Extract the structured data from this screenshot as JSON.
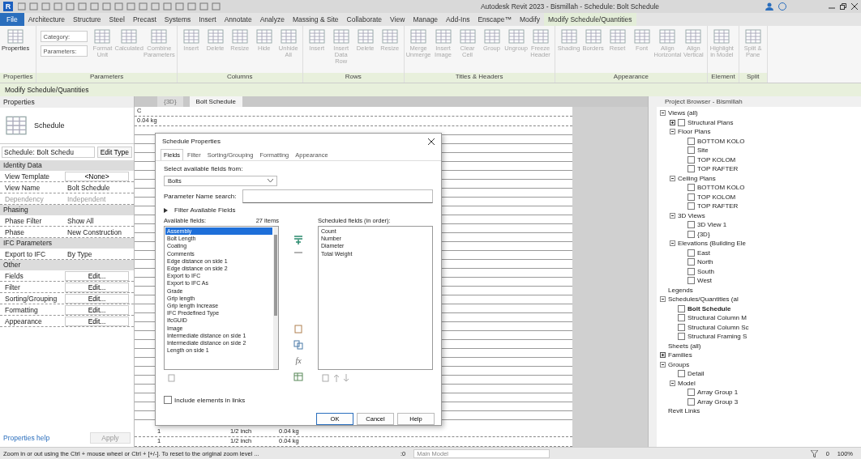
{
  "title_bar": {
    "logo": "R",
    "title": "Autodesk Revit 2023 - Bismillah - Schedule: Bolt Schedule"
  },
  "ribbon_tabs": [
    {
      "label": "File",
      "selected": false,
      "kind": "file"
    },
    {
      "label": "Architecture",
      "selected": false,
      "kind": "tab"
    },
    {
      "label": "Structure",
      "selected": false,
      "kind": "tab"
    },
    {
      "label": "Steel",
      "selected": false,
      "kind": "tab"
    },
    {
      "label": "Precast",
      "selected": false,
      "kind": "tab"
    },
    {
      "label": "Systems",
      "selected": false,
      "kind": "tab"
    },
    {
      "label": "Insert",
      "selected": false,
      "kind": "tab"
    },
    {
      "label": "Annotate",
      "selected": false,
      "kind": "tab"
    },
    {
      "label": "Analyze",
      "selected": false,
      "kind": "tab"
    },
    {
      "label": "Massing & Site",
      "selected": false,
      "kind": "tab"
    },
    {
      "label": "Collaborate",
      "selected": false,
      "kind": "tab"
    },
    {
      "label": "View",
      "selected": false,
      "kind": "tab"
    },
    {
      "label": "Manage",
      "selected": false,
      "kind": "tab"
    },
    {
      "label": "Add-Ins",
      "selected": false,
      "kind": "tab"
    },
    {
      "label": "Enscape™",
      "selected": false,
      "kind": "tab"
    },
    {
      "label": "Modify",
      "selected": false,
      "kind": "tab"
    },
    {
      "label": "Modify Schedule/Quantities",
      "selected": true,
      "kind": "tab"
    }
  ],
  "ribbon_panels": [
    {
      "label": "Properties",
      "buttons": [
        {
          "kind": "large",
          "label": "Properties",
          "disabled": false
        }
      ]
    },
    {
      "label": "Parameters",
      "buttons": [
        {
          "kind": "dropdowns",
          "items": [
            "Category:",
            "Parameters:"
          ]
        },
        {
          "kind": "large",
          "label": "Format Unit",
          "disabled": true
        },
        {
          "kind": "large",
          "label": "Calculated",
          "disabled": true
        },
        {
          "kind": "large",
          "label": "Combine Parameters",
          "disabled": true
        }
      ]
    },
    {
      "label": "Columns",
      "buttons": [
        {
          "kind": "large",
          "label": "Insert",
          "disabled": true
        },
        {
          "kind": "large",
          "label": "Delete",
          "disabled": true
        },
        {
          "kind": "large",
          "label": "Resize",
          "disabled": true
        },
        {
          "kind": "large",
          "label": "Hide",
          "disabled": true
        },
        {
          "kind": "large",
          "label": "Unhide All",
          "disabled": true
        }
      ]
    },
    {
      "label": "Rows",
      "buttons": [
        {
          "kind": "large",
          "label": "Insert",
          "disabled": true
        },
        {
          "kind": "large",
          "label": "Insert Data Row",
          "disabled": true
        },
        {
          "kind": "large",
          "label": "Delete",
          "disabled": true
        },
        {
          "kind": "large",
          "label": "Resize",
          "disabled": true
        }
      ]
    },
    {
      "label": "Titles & Headers",
      "buttons": [
        {
          "kind": "large",
          "label": "Merge Unmerge",
          "disabled": true
        },
        {
          "kind": "large",
          "label": "Insert Image",
          "disabled": true
        },
        {
          "kind": "large",
          "label": "Clear Cell",
          "disabled": true
        },
        {
          "kind": "large",
          "label": "Group",
          "disabled": true
        },
        {
          "kind": "large",
          "label": "Ungroup",
          "disabled": true
        },
        {
          "kind": "large",
          "label": "Freeze Header",
          "disabled": true
        }
      ]
    },
    {
      "label": "Appearance",
      "buttons": [
        {
          "kind": "large",
          "label": "Shading",
          "disabled": true
        },
        {
          "kind": "large",
          "label": "Borders",
          "disabled": true
        },
        {
          "kind": "large",
          "label": "Reset",
          "disabled": true
        },
        {
          "kind": "large",
          "label": "Font",
          "disabled": true
        },
        {
          "kind": "large",
          "label": "Align Horizontal",
          "disabled": true
        },
        {
          "kind": "large",
          "label": "Align Vertical",
          "disabled": true
        }
      ]
    },
    {
      "label": "Element",
      "buttons": [
        {
          "kind": "large",
          "label": "Highlight in Model",
          "disabled": true
        }
      ]
    },
    {
      "label": "Split",
      "buttons": [
        {
          "kind": "large",
          "label": "Split & Pane",
          "disabled": true
        }
      ]
    }
  ],
  "context_label": "Modify Schedule/Quantities",
  "properties": {
    "title": "Properties",
    "type_name": "Schedule",
    "instance": "Schedule: Bolt Schedu",
    "edit_type": "Edit Type",
    "groups": [
      {
        "name": "Identity Data",
        "rows": [
          {
            "label": "View Template",
            "value": "<None>",
            "kind": "button",
            "disabled": false
          },
          {
            "label": "View Name",
            "value": "Bolt Schedule",
            "kind": "text",
            "disabled": false
          },
          {
            "label": "Dependency",
            "value": "Independent",
            "kind": "text",
            "disabled": true
          }
        ]
      },
      {
        "name": "Phasing",
        "rows": [
          {
            "label": "Phase Filter",
            "value": "Show All",
            "kind": "text",
            "disabled": false
          },
          {
            "label": "Phase",
            "value": "New Construction",
            "kind": "text",
            "disabled": false
          }
        ]
      },
      {
        "name": "IFC Parameters",
        "rows": [
          {
            "label": "Export to IFC",
            "value": "By Type",
            "kind": "text",
            "disabled": false
          }
        ]
      },
      {
        "name": "Other",
        "rows": [
          {
            "label": "Fields",
            "value": "Edit...",
            "kind": "button",
            "disabled": false
          },
          {
            "label": "Filter",
            "value": "Edit...",
            "kind": "button",
            "disabled": false
          },
          {
            "label": "Sorting/Grouping",
            "value": "Edit...",
            "kind": "button",
            "disabled": false
          },
          {
            "label": "Formatting",
            "value": "Edit...",
            "kind": "button",
            "disabled": false
          },
          {
            "label": "Appearance",
            "value": "Edit...",
            "kind": "button",
            "disabled": false
          }
        ]
      }
    ],
    "help_link": "Properties help",
    "apply": "Apply"
  },
  "view_tabs": [
    {
      "label": "{3D}",
      "selected": false
    },
    {
      "label": "Bolt Schedule",
      "selected": true
    }
  ],
  "schedule": {
    "column_header": "C",
    "top_cell": "0.04 kg",
    "bottom_rows": [
      [
        "1",
        "1/2 inch",
        "0.04 kg"
      ],
      [
        "1",
        "1/2 inch",
        "0.04 kg"
      ]
    ]
  },
  "dialog": {
    "title": "Schedule Properties",
    "tabs": [
      {
        "label": "Fields",
        "selected": true
      },
      {
        "label": "Filter",
        "selected": false
      },
      {
        "label": "Sorting/Grouping",
        "selected": false
      },
      {
        "label": "Formatting",
        "selected": false
      },
      {
        "label": "Appearance",
        "selected": false
      }
    ],
    "source_label": "Select available fields from:",
    "source_value": "Bolts",
    "search_label": "Parameter Name search:",
    "filter_toggle": "Filter Available Fields",
    "available_label": "Available fields:",
    "available_count": "27 items",
    "available_fields": [
      {
        "label": "Assembly",
        "selected": true
      },
      {
        "label": "Bolt Length",
        "selected": false
      },
      {
        "label": "Coating",
        "selected": false
      },
      {
        "label": "Comments",
        "selected": false
      },
      {
        "label": "Edge distance on side 1",
        "selected": false
      },
      {
        "label": "Edge distance on side 2",
        "selected": false
      },
      {
        "label": "Export to IFC",
        "selected": false
      },
      {
        "label": "Export to IFC As",
        "selected": false
      },
      {
        "label": "Grade",
        "selected": false
      },
      {
        "label": "Grip length",
        "selected": false
      },
      {
        "label": "Grip length Increase",
        "selected": false
      },
      {
        "label": "IFC Predefined Type",
        "selected": false
      },
      {
        "label": "IfcGUID",
        "selected": false
      },
      {
        "label": "Image",
        "selected": false
      },
      {
        "label": "Intermediate distance on side 1",
        "selected": false
      },
      {
        "label": "Intermediate distance on side 2",
        "selected": false
      },
      {
        "label": "Length on side 1",
        "selected": false
      }
    ],
    "formula_symbol": "fx",
    "scheduled_label": "Scheduled fields (in order):",
    "scheduled_fields": [
      {
        "label": "Count",
        "selected": false
      },
      {
        "label": "Number",
        "selected": false
      },
      {
        "label": "Diameter",
        "selected": false
      },
      {
        "label": "Total Weight",
        "selected": false
      }
    ],
    "include_links": {
      "label": "Include elements in links",
      "checked": false
    },
    "buttons": [
      "OK",
      "Cancel",
      "Help"
    ]
  },
  "project_browser": {
    "title": "Project Browser - Bismillah",
    "tree": [
      {
        "label": "Views (all)",
        "expanded": true,
        "selected": false,
        "children": [
          {
            "label": "Structural Plans",
            "expanded": false,
            "selected": false
          },
          {
            "label": "Floor Plans",
            "expanded": true,
            "selected": false,
            "children": [
              {
                "label": "BOTTOM KOLO",
                "selected": false
              },
              {
                "label": "Site",
                "selected": false
              },
              {
                "label": "TOP KOLOM",
                "selected": false
              },
              {
                "label": "TOP RAFTER",
                "selected": false
              }
            ]
          },
          {
            "label": "Ceiling Plans",
            "expanded": true,
            "selected": false,
            "children": [
              {
                "label": "BOTTOM KOLO",
                "selected": false
              },
              {
                "label": "TOP KOLOM",
                "selected": false
              },
              {
                "label": "TOP RAFTER",
                "selected": false
              }
            ]
          },
          {
            "label": "3D Views",
            "expanded": true,
            "selected": false,
            "children": [
              {
                "label": "3D View 1",
                "selected": false
              },
              {
                "label": "{3D}",
                "selected": false
              }
            ]
          },
          {
            "label": "Elevations (Building Ele",
            "expanded": true,
            "selected": false,
            "children": [
              {
                "label": "East",
                "selected": false
              },
              {
                "label": "North",
                "selected": false
              },
              {
                "label": "South",
                "selected": false
              },
              {
                "label": "West",
                "selected": false
              }
            ]
          }
        ]
      },
      {
        "label": "Legends",
        "selected": false
      },
      {
        "label": "Schedules/Quantities (al",
        "expanded": true,
        "selected": false,
        "children": [
          {
            "label": "Bolt Schedule",
            "selected": true
          },
          {
            "label": "Structural Column M",
            "selected": false
          },
          {
            "label": "Structural Column Sc",
            "selected": false
          },
          {
            "label": "Structural Framing S",
            "selected": false
          }
        ]
      },
      {
        "label": "Sheets (all)",
        "selected": false
      },
      {
        "label": "Families",
        "expanded": false,
        "selected": false
      },
      {
        "label": "Groups",
        "expanded": true,
        "selected": false,
        "children": [
          {
            "label": "Detail",
            "selected": false
          },
          {
            "label": "Model",
            "expanded": true,
            "selected": false,
            "children": [
              {
                "label": "Array Group 1",
                "selected": false
              },
              {
                "label": "Array Group 3",
                "selected": false
              }
            ]
          }
        ]
      },
      {
        "label": "Revit Links",
        "selected": false
      }
    ]
  },
  "status_bar": {
    "message": "Zoom in or out using the Ctrl + mouse wheel or Ctrl + [+/-]. To reset to the original zoom level ...",
    "workset_count": ":0",
    "workset": "Main Model",
    "filter_count": "0",
    "zoom": "100%"
  }
}
